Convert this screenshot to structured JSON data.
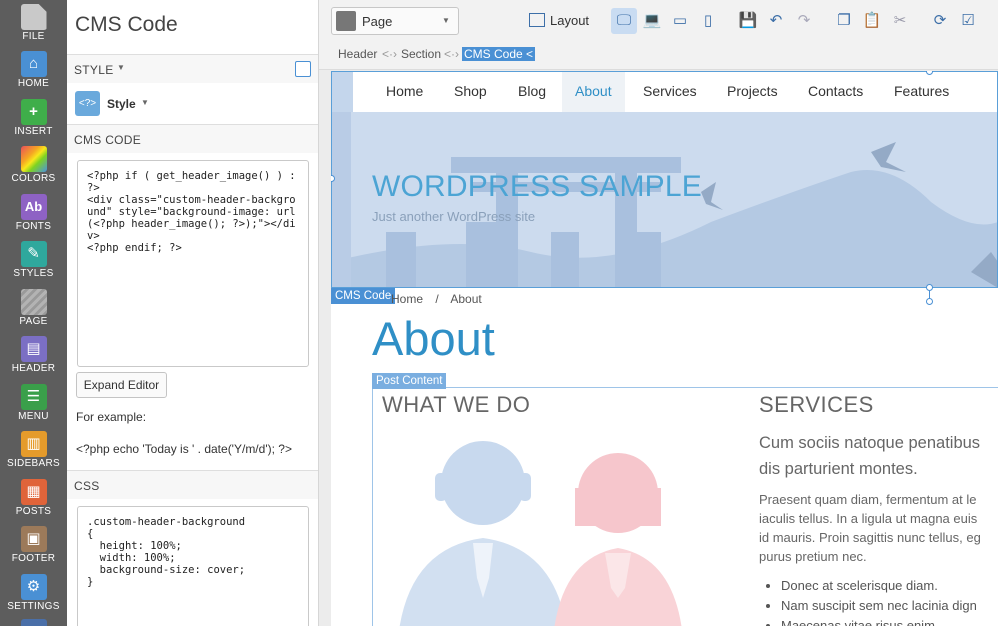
{
  "toolbar": {
    "items": [
      {
        "label": "FILE",
        "icon": "file-icon",
        "color": "#c9c9c9"
      },
      {
        "label": "HOME",
        "icon": "home-icon",
        "color": "#4a90d4"
      },
      {
        "label": "INSERT",
        "icon": "plus-icon",
        "color": "#3fae4a"
      },
      {
        "label": "COLORS",
        "icon": "palette-icon",
        "color": "#e94f5b"
      },
      {
        "label": "FONTS",
        "icon": "font-icon",
        "color": "#8e62c4"
      },
      {
        "label": "STYLES",
        "icon": "styles-icon",
        "color": "#2fa89d"
      },
      {
        "label": "PAGE",
        "icon": "page-icon",
        "color": "#a8a8a8"
      },
      {
        "label": "HEADER",
        "icon": "header-icon",
        "color": "#7b6fc4"
      },
      {
        "label": "MENU",
        "icon": "menu-icon",
        "color": "#3a9f4a"
      },
      {
        "label": "SIDEBARS",
        "icon": "sidebars-icon",
        "color": "#e59b2b"
      },
      {
        "label": "POSTS",
        "icon": "posts-icon",
        "color": "#e0643a"
      },
      {
        "label": "FOOTER",
        "icon": "footer-icon",
        "color": "#9c7a5a"
      },
      {
        "label": "SETTINGS",
        "icon": "gear-icon",
        "color": "#4a90d4"
      }
    ]
  },
  "panel": {
    "title": "CMS Code",
    "style_section": "STYLE",
    "style_selector": "Style",
    "cms_section": "CMS CODE",
    "cms_code": "<?php if ( get_header_image() ) : ?>\n<div class=\"custom-header-background\" style=\"background-image: url(<?php header_image(); ?>);\"></div>\n<?php endif; ?>",
    "expand_button": "Expand Editor",
    "example_label": "For example:",
    "example_code": "<?php echo 'Today is ' . date('Y/m/d'); ?>",
    "css_section": "CSS",
    "css_code": ".custom-header-background\n{\n  height: 100%;\n  width: 100%;\n  background-size: cover;\n}"
  },
  "topbar": {
    "page_select": "Page",
    "layout_label": "Layout"
  },
  "breadcrumbs": [
    "Header",
    "Section",
    "CMS Code"
  ],
  "canvas": {
    "nav": [
      "Home",
      "Shop",
      "Blog",
      "About",
      "Services",
      "Projects",
      "Contacts",
      "Features"
    ],
    "active_nav": "About",
    "site_title": "WORDPRESS SAMPLE",
    "tagline": "Just another WordPress site",
    "cms_badge": "CMS Code",
    "breadcrumb_home": "Home",
    "breadcrumb_sep": "/",
    "breadcrumb_current": "About",
    "page_heading": "About",
    "post_content_badge": "Post Content",
    "col1_heading": "WHAT WE DO",
    "col2_heading": "SERVICES",
    "lead_line1": "Cum sociis natoque penatibus",
    "lead_line2": "dis parturient montes.",
    "para_lines": [
      "Praesent quam diam, fermentum at le",
      "iaculis tellus. In a ligula ut magna euis",
      "id mauris. Proin sagittis nunc tellus, eg",
      "purus pretium nec."
    ],
    "bullets": [
      "Donec at scelerisque diam.",
      "Nam suscipit sem nec lacinia dign",
      "Maecenas vitae risus enim"
    ]
  },
  "colors": {
    "accent": "#4a90d4",
    "heading_blue": "#2f8fc6",
    "toolbar_bg": "#5d5d5d"
  }
}
